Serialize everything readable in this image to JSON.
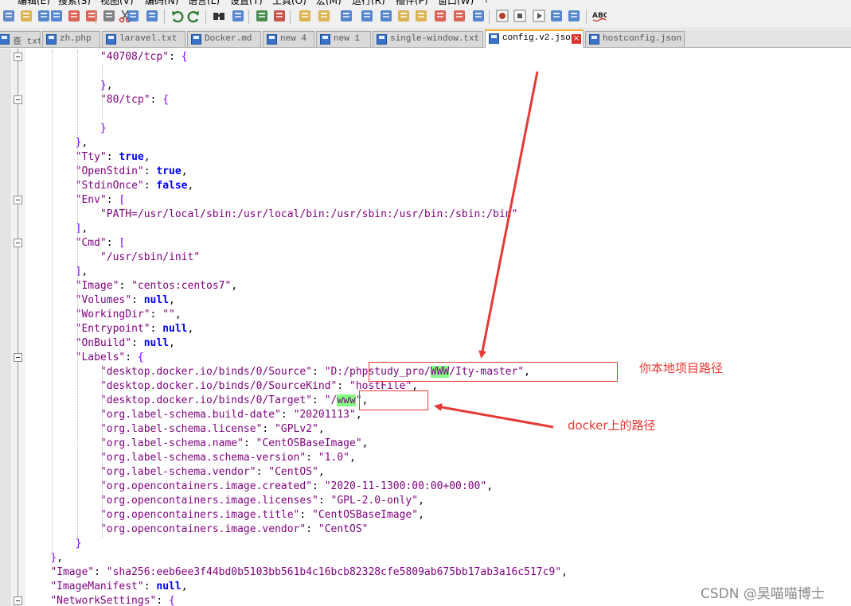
{
  "menu": [
    "编辑(E)",
    "搜索(S)",
    "视图(V)",
    "编码(N)",
    "语言(L)",
    "设置(T)",
    "工具(O)",
    "宏(M)",
    "运行(R)",
    "插件(P)",
    "窗口(W)",
    "?"
  ],
  "toolbar_icons": [
    "new-file-icon",
    "open-icon",
    "save-icon",
    "save-all-icon",
    "close-icon",
    "close-all-icon",
    "print-icon",
    "cut-icon",
    "copy-icon",
    "paste-icon",
    "undo-icon",
    "redo-icon",
    "find-icon",
    "replace-icon",
    "zoom-in-icon",
    "zoom-out-icon",
    "sync-vertical-icon",
    "sync-horizontal-icon",
    "word-wrap-icon",
    "show-all-chars-icon",
    "indent-guide-icon",
    "language-icon",
    "doc-map-icon",
    "function-list-icon",
    "folder-workspace-icon",
    "monitor-icon",
    "record-macro-icon",
    "stop-macro-icon",
    "play-macro-icon",
    "run-multiple-macro-icon",
    "save-macro-icon",
    "spellcheck-icon"
  ],
  "tabs": [
    {
      "label": "查 txt",
      "active": false
    },
    {
      "label": "zh.php",
      "active": false
    },
    {
      "label": "laravel.txt",
      "active": false
    },
    {
      "label": "Docker.md",
      "active": false
    },
    {
      "label": "new 4",
      "active": false
    },
    {
      "label": "new 1",
      "active": false
    },
    {
      "label": "single-window.txt",
      "active": false
    },
    {
      "label": "config.v2.json",
      "active": true
    },
    {
      "label": "hostconfig.json",
      "active": false
    }
  ],
  "code": [
    "            \"40708/tcp\": {",
    "",
    "            },",
    "            \"80/tcp\": {",
    "",
    "            }",
    "        },",
    "        \"Tty\": true,",
    "        \"OpenStdin\": true,",
    "        \"StdinOnce\": false,",
    "        \"Env\": [",
    "            \"PATH=/usr/local/sbin:/usr/local/bin:/usr/sbin:/usr/bin:/sbin:/bin\"",
    "        ],",
    "        \"Cmd\": [",
    "            \"/usr/sbin/init\"",
    "        ],",
    "        \"Image\": \"centos:centos7\",",
    "        \"Volumes\": null,",
    "        \"WorkingDir\": \"\",",
    "        \"Entrypoint\": null,",
    "        \"OnBuild\": null,",
    "        \"Labels\": {",
    "            \"desktop.docker.io/binds/0/Source\": \"D:/phpstudy_pro/WWW/Ity-master\",",
    "            \"desktop.docker.io/binds/0/SourceKind\": \"hostFile\",",
    "            \"desktop.docker.io/binds/0/Target\": \"/www\",",
    "            \"org.label-schema.build-date\": \"20201113\",",
    "            \"org.label-schema.license\": \"GPLv2\",",
    "            \"org.label-schema.name\": \"CentOSBaseImage\",",
    "            \"org.label-schema.schema-version\": \"1.0\",",
    "            \"org.label-schema.vendor\": \"CentOS\",",
    "            \"org.opencontainers.image.created\": \"2020-11-1300:00:00+00:00\",",
    "            \"org.opencontainers.image.licenses\": \"GPL-2.0-only\",",
    "            \"org.opencontainers.image.title\": \"CentOSBaseImage\",",
    "            \"org.opencontainers.image.vendor\": \"CentOS\"",
    "        }",
    "    },",
    "    \"Image\": \"sha256:eeb6ee3f44bd0b5103bb561b4c16bcb82328cfe5809ab675bb17ab3a16c517c9\",",
    "    \"ImageManifest\": null,",
    "    \"NetworkSettings\": {"
  ],
  "search_highlight": [
    "WWW",
    "www"
  ],
  "fold_lines": [
    0,
    3,
    10,
    13,
    21,
    38
  ],
  "annotations": {
    "source_label": "你本地项目路径",
    "target_label": "docker上的路径",
    "color": "#e53935"
  },
  "watermark": "CSDN @昊喵喵博士",
  "colors": {
    "string": "#7f007f",
    "keyword": "#0000ff",
    "bracket": "#8000ff",
    "highlight": "#7fff7f",
    "active_tab_accent": "#f5a623"
  }
}
